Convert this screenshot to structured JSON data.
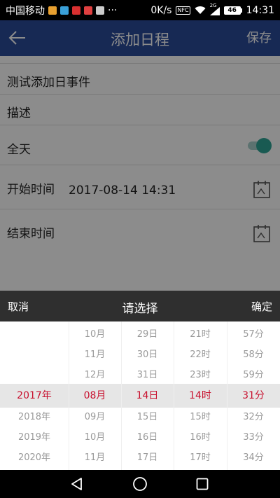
{
  "status_bar": {
    "carrier": "中国移动",
    "net_speed": "0K/s",
    "nfc": "NFC",
    "signal_tag": "2G",
    "battery": "46",
    "time": "14:31",
    "app_icon_colors": [
      "#e8a030",
      "#3aa0d8",
      "#d83030",
      "#e04040",
      "#cccccc"
    ]
  },
  "header": {
    "title": "添加日程",
    "save_label": "保存",
    "back_icon": "arrow-left-icon"
  },
  "form": {
    "event_title": "测试添加日事件",
    "description": "描述",
    "all_day_label": "全天",
    "all_day_on": true,
    "start_label": "开始时间",
    "start_value": "2017-08-14 14:31",
    "end_label": "结束时间",
    "end_value": "",
    "calendar_icon": "calendar-icon"
  },
  "picker": {
    "cancel_label": "取消",
    "title": "请选择",
    "confirm_label": "确定",
    "selected_color": "#c8102e",
    "columns": [
      {
        "name": "year",
        "items": [
          "",
          "",
          "",
          "2017年",
          "2018年",
          "2019年",
          "2020年"
        ]
      },
      {
        "name": "month",
        "items": [
          "10月",
          "11月",
          "12月",
          "08月",
          "09月",
          "10月",
          "11月"
        ]
      },
      {
        "name": "day",
        "items": [
          "29日",
          "30日",
          "31日",
          "14日",
          "15日",
          "16日",
          "17日"
        ]
      },
      {
        "name": "hour",
        "items": [
          "21时",
          "22时",
          "23时",
          "14时",
          "15时",
          "16时",
          "17时"
        ]
      },
      {
        "name": "minute",
        "items": [
          "57分",
          "58分",
          "59分",
          "31分",
          "32分",
          "33分",
          "34分"
        ]
      }
    ]
  },
  "nav_bar": {
    "back_icon": "triangle-back-icon",
    "home_icon": "circle-home-icon",
    "recents_icon": "square-recents-icon"
  }
}
